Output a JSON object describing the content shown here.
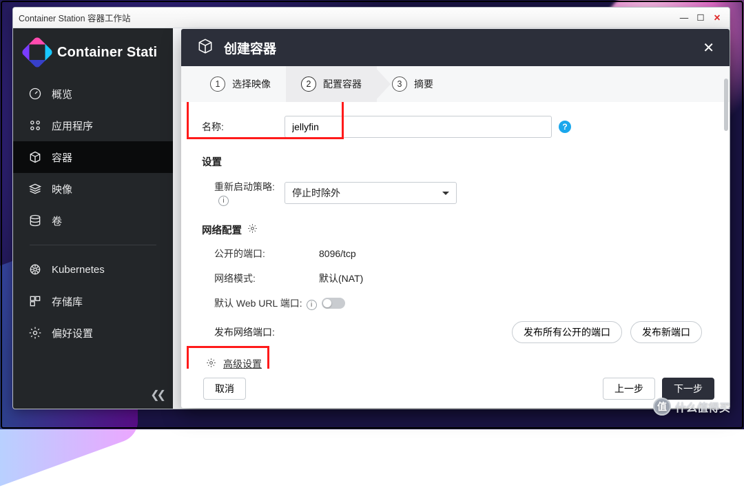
{
  "window": {
    "title": "Container Station 容器工作站"
  },
  "brand": {
    "name": "Container Stati"
  },
  "sidebar": {
    "items": [
      {
        "label": "概览"
      },
      {
        "label": "应用程序"
      },
      {
        "label": "容器"
      },
      {
        "label": "映像"
      },
      {
        "label": "卷"
      },
      {
        "label": "Kubernetes"
      },
      {
        "label": "存储库"
      },
      {
        "label": "偏好设置"
      }
    ],
    "active_index": 2
  },
  "bg_counter": "0",
  "dialog": {
    "title": "创建容器",
    "steps": [
      {
        "num": "1",
        "label": "选择映像"
      },
      {
        "num": "2",
        "label": "配置容器"
      },
      {
        "num": "3",
        "label": "摘要"
      }
    ],
    "active_step_index": 1,
    "form": {
      "name_label": "名称:",
      "name_value": "jellyfin",
      "settings_title": "设置",
      "restart_label": "重新启动策略:",
      "restart_value": "停止时除外",
      "network_title": "网络配置",
      "port_label": "公开的端口:",
      "port_value": "8096/tcp",
      "netmode_label": "网络模式:",
      "netmode_value": "默认(NAT)",
      "weburl_label": "默认 Web URL 端口:",
      "publish_label": "发布网络端口:",
      "publish_all": "发布所有公开的端口",
      "publish_new": "发布新端口",
      "advanced": "高级设置"
    },
    "footer": {
      "cancel": "取消",
      "prev": "上一步",
      "next": "下一步"
    }
  },
  "watermark": {
    "text": "什么值得买",
    "badge": "值"
  }
}
